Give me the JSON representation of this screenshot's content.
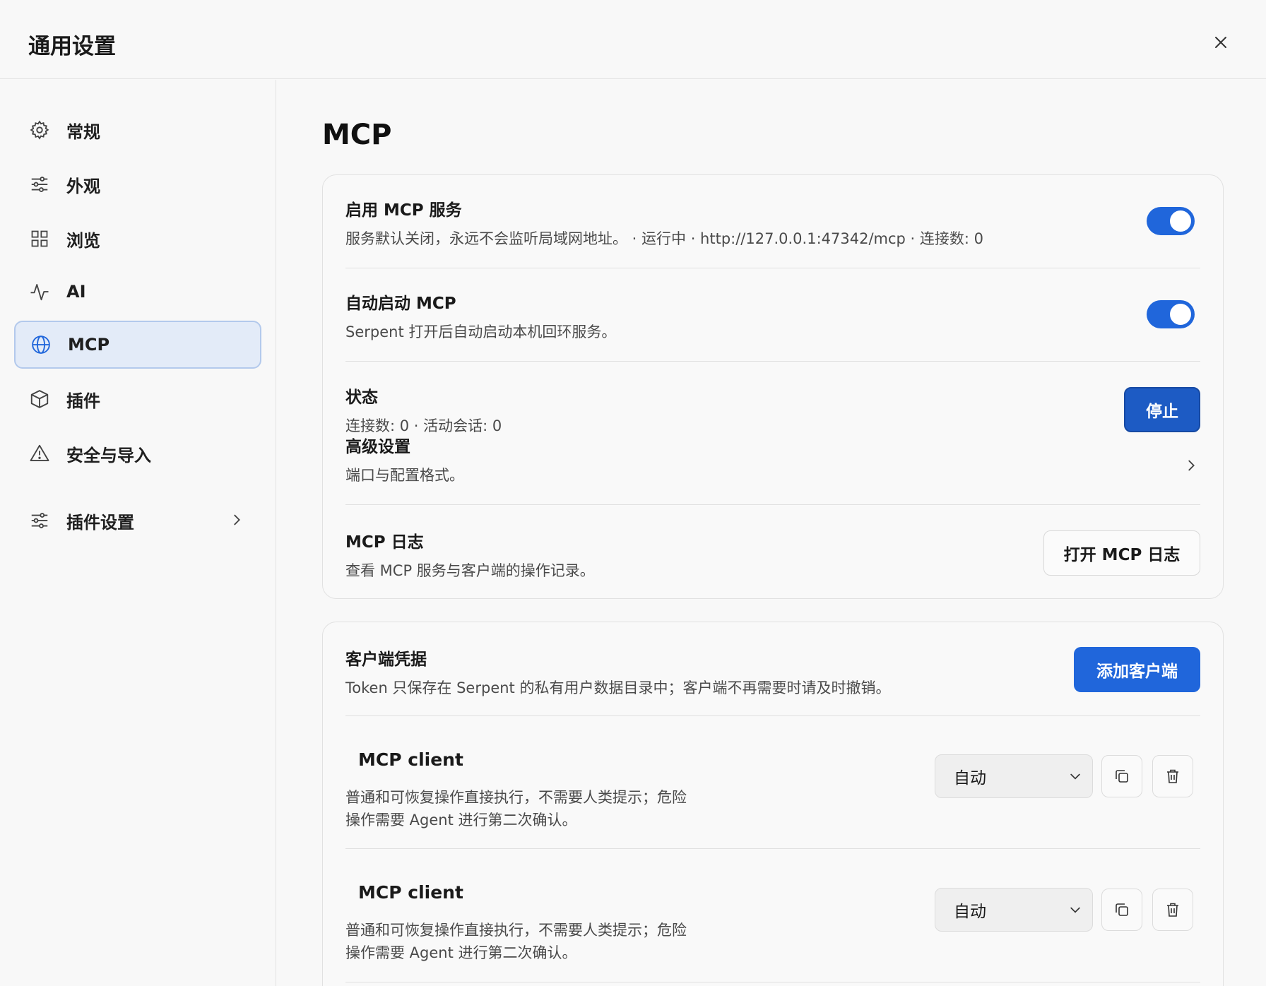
{
  "header": {
    "title": "通用设置",
    "close_icon": "close-icon"
  },
  "sidebar": {
    "items": [
      {
        "label": "常规",
        "icon": "gear-icon"
      },
      {
        "label": "外观",
        "icon": "sliders-icon"
      },
      {
        "label": "浏览",
        "icon": "grid-icon"
      },
      {
        "label": "AI",
        "icon": "activity-icon"
      },
      {
        "label": "MCP",
        "icon": "globe-icon",
        "active": true
      },
      {
        "label": "插件",
        "icon": "cube-icon"
      },
      {
        "label": "安全与导入",
        "icon": "warning-icon"
      },
      {
        "label": "插件设置",
        "icon": "sliders-icon",
        "chevron": true
      }
    ]
  },
  "main": {
    "title": "MCP",
    "service_card": {
      "enable": {
        "title": "启用 MCP 服务",
        "desc": "服务默认关闭，永远不会监听局域网地址。 · 运行中 · http://127.0.0.1:47342/mcp · 连接数: 0",
        "toggle_on": true
      },
      "autostart": {
        "title": "自动启动 MCP",
        "desc": "Serpent 打开后自动启动本机回环服务。",
        "toggle_on": true
      },
      "status": {
        "title": "状态",
        "desc": "连接数: 0 · 活动会话: 0",
        "stop_label": "停止"
      },
      "advanced": {
        "title": "高级设置",
        "desc": "端口与配置格式。"
      },
      "log": {
        "title": "MCP 日志",
        "desc": "查看 MCP 服务与客户端的操作记录。",
        "button_label": "打开 MCP 日志"
      }
    },
    "clients_card": {
      "title": "客户端凭据",
      "desc": "Token 只保存在 Serpent 的私有用户数据目录中；客户端不再需要时请及时撤销。",
      "add_label": "添加客户端",
      "clients": [
        {
          "name": "MCP client",
          "desc_line1": "普通和可恢复操作直接执行，不需要人类提示；危险",
          "desc_line2": "操作需要 Agent 进行第二次确认。",
          "mode": "自动"
        },
        {
          "name": "MCP client",
          "desc_line1": "普通和可恢复操作直接执行，不需要人类提示；危险",
          "desc_line2": "操作需要 Agent 进行第二次确认。",
          "mode": "自动"
        }
      ]
    }
  },
  "colors": {
    "accent": "#2066db",
    "active_bg": "#e3ebf8",
    "active_border": "#b3c9ec"
  }
}
